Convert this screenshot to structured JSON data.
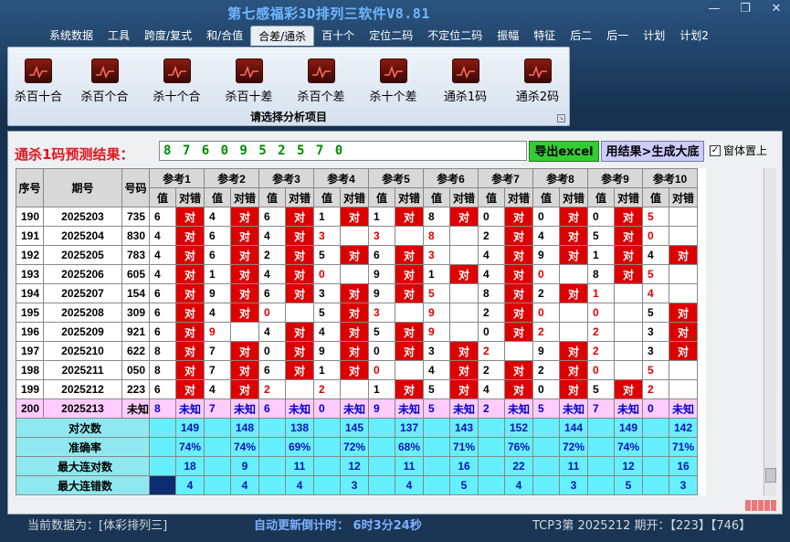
{
  "window": {
    "title": "第七感福彩3D排列三软件V8.81"
  },
  "menu": [
    "系统数据",
    "工具",
    "跨度/复式",
    "和/合值",
    "合差/通杀",
    "百十个",
    "定位二码",
    "不定位二码",
    "振幅",
    "特征",
    "后二",
    "后一",
    "计划",
    "计划2"
  ],
  "menu_active": 4,
  "ribbon": {
    "group_label": "请选择分析项目",
    "buttons": [
      "杀百十合",
      "杀百个合",
      "杀十个合",
      "杀百十差",
      "杀百个差",
      "杀十个差",
      "通杀1码",
      "通杀2码"
    ]
  },
  "prediction": {
    "label": "通杀1码预测结果：",
    "value": "8 7 6 0 9 5 2 5 7 0"
  },
  "buttons": {
    "excel": "导出excel",
    "generate": "用结果>生成大底",
    "topmost": "窗体置上"
  },
  "table": {
    "headers": {
      "seq": "序号",
      "period": "期号",
      "number": "号码",
      "refs": [
        "参考1",
        "参考2",
        "参考3",
        "参考4",
        "参考5",
        "参考6",
        "参考7",
        "参考8",
        "参考9",
        "参考10"
      ],
      "val": "值",
      "hit": "对错"
    },
    "rows": [
      {
        "seq": "190",
        "period": "2025203",
        "number": "735",
        "vals": [
          "6",
          "4",
          "6",
          "1",
          "1",
          "8",
          "0",
          "0",
          "0",
          "5"
        ],
        "hits": [
          1,
          1,
          1,
          1,
          1,
          1,
          1,
          1,
          1,
          0
        ]
      },
      {
        "seq": "191",
        "period": "2025204",
        "number": "830",
        "vals": [
          "4",
          "6",
          "4",
          "3",
          "3",
          "8",
          "2",
          "4",
          "5",
          "0"
        ],
        "hits": [
          1,
          1,
          1,
          0,
          0,
          0,
          1,
          1,
          1,
          0
        ]
      },
      {
        "seq": "192",
        "period": "2025205",
        "number": "783",
        "vals": [
          "4",
          "6",
          "2",
          "5",
          "6",
          "3",
          "4",
          "9",
          "1",
          "4"
        ],
        "hits": [
          1,
          1,
          1,
          1,
          1,
          0,
          1,
          1,
          1,
          1
        ]
      },
      {
        "seq": "193",
        "period": "2025206",
        "number": "605",
        "vals": [
          "4",
          "1",
          "4",
          "0",
          "9",
          "1",
          "4",
          "0",
          "8",
          "5"
        ],
        "hits": [
          1,
          1,
          1,
          0,
          1,
          1,
          1,
          0,
          1,
          0
        ]
      },
      {
        "seq": "194",
        "period": "2025207",
        "number": "154",
        "vals": [
          "6",
          "9",
          "6",
          "3",
          "9",
          "5",
          "8",
          "2",
          "1",
          "4"
        ],
        "hits": [
          1,
          1,
          1,
          1,
          1,
          0,
          1,
          1,
          0,
          0
        ]
      },
      {
        "seq": "195",
        "period": "2025208",
        "number": "309",
        "vals": [
          "6",
          "4",
          "0",
          "5",
          "3",
          "9",
          "2",
          "0",
          "0",
          "5"
        ],
        "hits": [
          1,
          1,
          0,
          1,
          0,
          0,
          1,
          0,
          0,
          1
        ]
      },
      {
        "seq": "196",
        "period": "2025209",
        "number": "921",
        "vals": [
          "6",
          "9",
          "4",
          "4",
          "5",
          "9",
          "0",
          "2",
          "2",
          "3"
        ],
        "hits": [
          1,
          0,
          1,
          1,
          1,
          0,
          1,
          0,
          0,
          1
        ]
      },
      {
        "seq": "197",
        "period": "2025210",
        "number": "622",
        "vals": [
          "8",
          "7",
          "0",
          "9",
          "0",
          "3",
          "2",
          "9",
          "2",
          "3"
        ],
        "hits": [
          1,
          1,
          1,
          1,
          1,
          1,
          0,
          1,
          0,
          1
        ]
      },
      {
        "seq": "198",
        "period": "2025211",
        "number": "050",
        "vals": [
          "8",
          "7",
          "6",
          "1",
          "0",
          "4",
          "2",
          "2",
          "0",
          "5"
        ],
        "hits": [
          1,
          1,
          1,
          1,
          0,
          1,
          1,
          1,
          0,
          0
        ]
      },
      {
        "seq": "199",
        "period": "2025212",
        "number": "223",
        "vals": [
          "6",
          "4",
          "2",
          "2",
          "1",
          "5",
          "4",
          "0",
          "5",
          "2"
        ],
        "hits": [
          1,
          1,
          0,
          0,
          1,
          1,
          1,
          1,
          1,
          0
        ]
      }
    ],
    "last_row": {
      "seq": "200",
      "period": "2025213",
      "number": "未知",
      "vals": [
        "8",
        "7",
        "6",
        "0",
        "9",
        "5",
        "2",
        "5",
        "7",
        "0"
      ],
      "hit_text": "未知"
    },
    "red_vals": [
      [
        0,
        0,
        0,
        0,
        0,
        0,
        0,
        0,
        0,
        1
      ],
      [
        0,
        0,
        0,
        1,
        1,
        1,
        0,
        0,
        0,
        1
      ],
      [
        0,
        0,
        0,
        0,
        0,
        1,
        0,
        0,
        0,
        0
      ],
      [
        0,
        0,
        0,
        1,
        0,
        0,
        0,
        1,
        0,
        1
      ],
      [
        0,
        0,
        0,
        0,
        0,
        1,
        0,
        0,
        1,
        1
      ],
      [
        0,
        0,
        1,
        0,
        1,
        1,
        0,
        1,
        1,
        0
      ],
      [
        0,
        1,
        0,
        0,
        0,
        1,
        0,
        1,
        1,
        0
      ],
      [
        0,
        0,
        0,
        0,
        0,
        0,
        1,
        0,
        1,
        0
      ],
      [
        0,
        0,
        0,
        0,
        1,
        0,
        0,
        0,
        1,
        1
      ],
      [
        0,
        0,
        1,
        1,
        0,
        0,
        0,
        0,
        0,
        1
      ]
    ],
    "hit_text": "对",
    "summary": [
      {
        "label": "对次数",
        "values": [
          "149",
          "148",
          "138",
          "145",
          "137",
          "143",
          "152",
          "144",
          "149",
          "142"
        ]
      },
      {
        "label": "准确率",
        "values": [
          "74%",
          "74%",
          "69%",
          "72%",
          "68%",
          "71%",
          "76%",
          "72%",
          "74%",
          "71%"
        ]
      },
      {
        "label": "最大连对数",
        "values": [
          "18",
          "9",
          "11",
          "12",
          "11",
          "16",
          "22",
          "11",
          "12",
          "16"
        ]
      },
      {
        "label": "最大连错数",
        "values": [
          "4",
          "4",
          "4",
          "3",
          "4",
          "5",
          "4",
          "3",
          "5",
          "3"
        ]
      }
    ]
  },
  "status": {
    "data_source": "当前数据为：[体彩排列三]",
    "countdown": "自动更新倒计时：  6时3分24秒",
    "latest": "TCP3第 2025212 期开：【223】【746】"
  },
  "colors": {
    "hit": "#dd0000",
    "pending": "#ffccff",
    "summary": "#66f0ff",
    "prediction_text": "#008a00"
  }
}
